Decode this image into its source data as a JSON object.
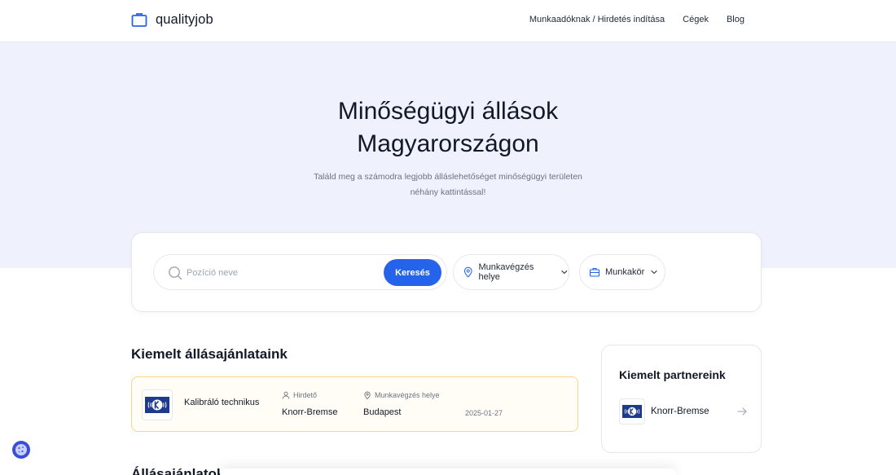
{
  "header": {
    "logo_text": "qualityjob",
    "nav": [
      {
        "label": "Munkaadóknak / Hirdetés indítása"
      },
      {
        "label": "Cégek"
      },
      {
        "label": "Blog"
      }
    ]
  },
  "hero": {
    "title_line1": "Minőségügyi állások",
    "title_line2": "Magyarországon",
    "subtitle_line1": "Találd meg a számodra legjobb álláslehetőséget minőségügyi területen",
    "subtitle_line2": "néhány kattintással!"
  },
  "search": {
    "placeholder": "Pozíció neve",
    "button_label": "Keresés",
    "location_label": "Munkavégzés helye",
    "role_label": "Munkakör"
  },
  "featured": {
    "title": "Kiemelt állásajánlataink",
    "jobs": [
      {
        "title": "Kalibráló technikus",
        "advertiser_label": "Hirdető",
        "advertiser": "Knorr-Bremse",
        "location_label": "Munkavégzés helye",
        "location": "Budapest",
        "date": "2025-01-27"
      }
    ]
  },
  "partners": {
    "title": "Kiemelt partnereink",
    "items": [
      {
        "name": "Knorr-Bremse"
      }
    ]
  },
  "all_jobs": {
    "title": "Állásajánlatok"
  },
  "colors": {
    "accent": "#2563eb",
    "hero_bg": "#eff1fc",
    "featured_border": "#fcd48a",
    "brand_logo": "#1e3a8a"
  },
  "icons": {
    "logo": "briefcase-icon",
    "search": "search-icon",
    "location": "map-pin-icon",
    "role": "briefcase-icon",
    "chevron": "chevron-down-icon",
    "user": "user-icon",
    "arrow": "arrow-right-icon",
    "cookie": "cookie-icon"
  }
}
